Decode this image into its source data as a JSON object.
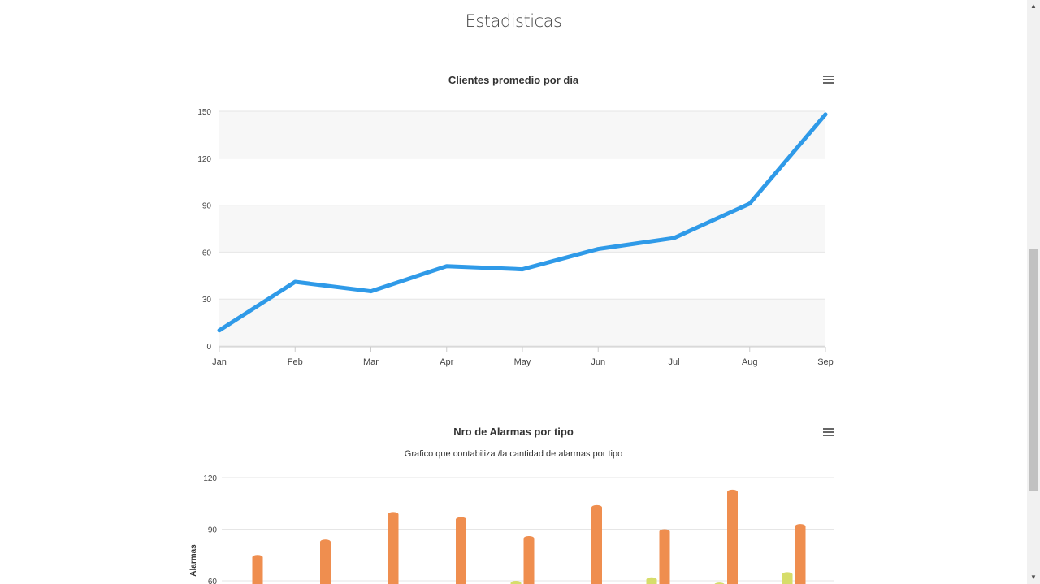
{
  "page": {
    "title": "Estadisticas"
  },
  "colors": {
    "line": "#2f9ae8",
    "bar_main": "#ef8e4f",
    "bar_secondary": "#d6dd6a",
    "plot_band": "#f7f7f7",
    "grid": "#e6e6e6",
    "text": "#333333"
  },
  "menu_icon": "hamburger-menu-icon",
  "chart_data": [
    {
      "type": "line",
      "title": "Clientes promedio por dia",
      "subtitle": "",
      "xlabel": "",
      "ylabel": "",
      "categories": [
        "Jan",
        "Feb",
        "Mar",
        "Apr",
        "May",
        "Jun",
        "Jul",
        "Aug",
        "Sep"
      ],
      "ylim": [
        0,
        150
      ],
      "yticks": [
        "0",
        "30",
        "60",
        "90",
        "120",
        "150"
      ],
      "series": [
        {
          "values": [
            10,
            41,
            35,
            51,
            49,
            62,
            69,
            91,
            148
          ]
        }
      ],
      "grid": true,
      "alternate_bands": true
    },
    {
      "type": "bar",
      "title": "Nro de Alarmas por tipo",
      "subtitle": "Grafico que contabiliza /la cantidad de alarmas por tipo",
      "xlabel": "",
      "ylabel": "Alarmas",
      "yticks": [
        "60",
        "90",
        "120"
      ],
      "ylim": [
        60,
        120
      ],
      "series": [
        {
          "values": [
            null,
            null,
            null,
            null,
            60,
            null,
            62,
            59,
            65
          ]
        },
        {
          "values": [
            75,
            84,
            100,
            97,
            86,
            104,
            90,
            113,
            93
          ]
        }
      ],
      "grid": true
    }
  ]
}
